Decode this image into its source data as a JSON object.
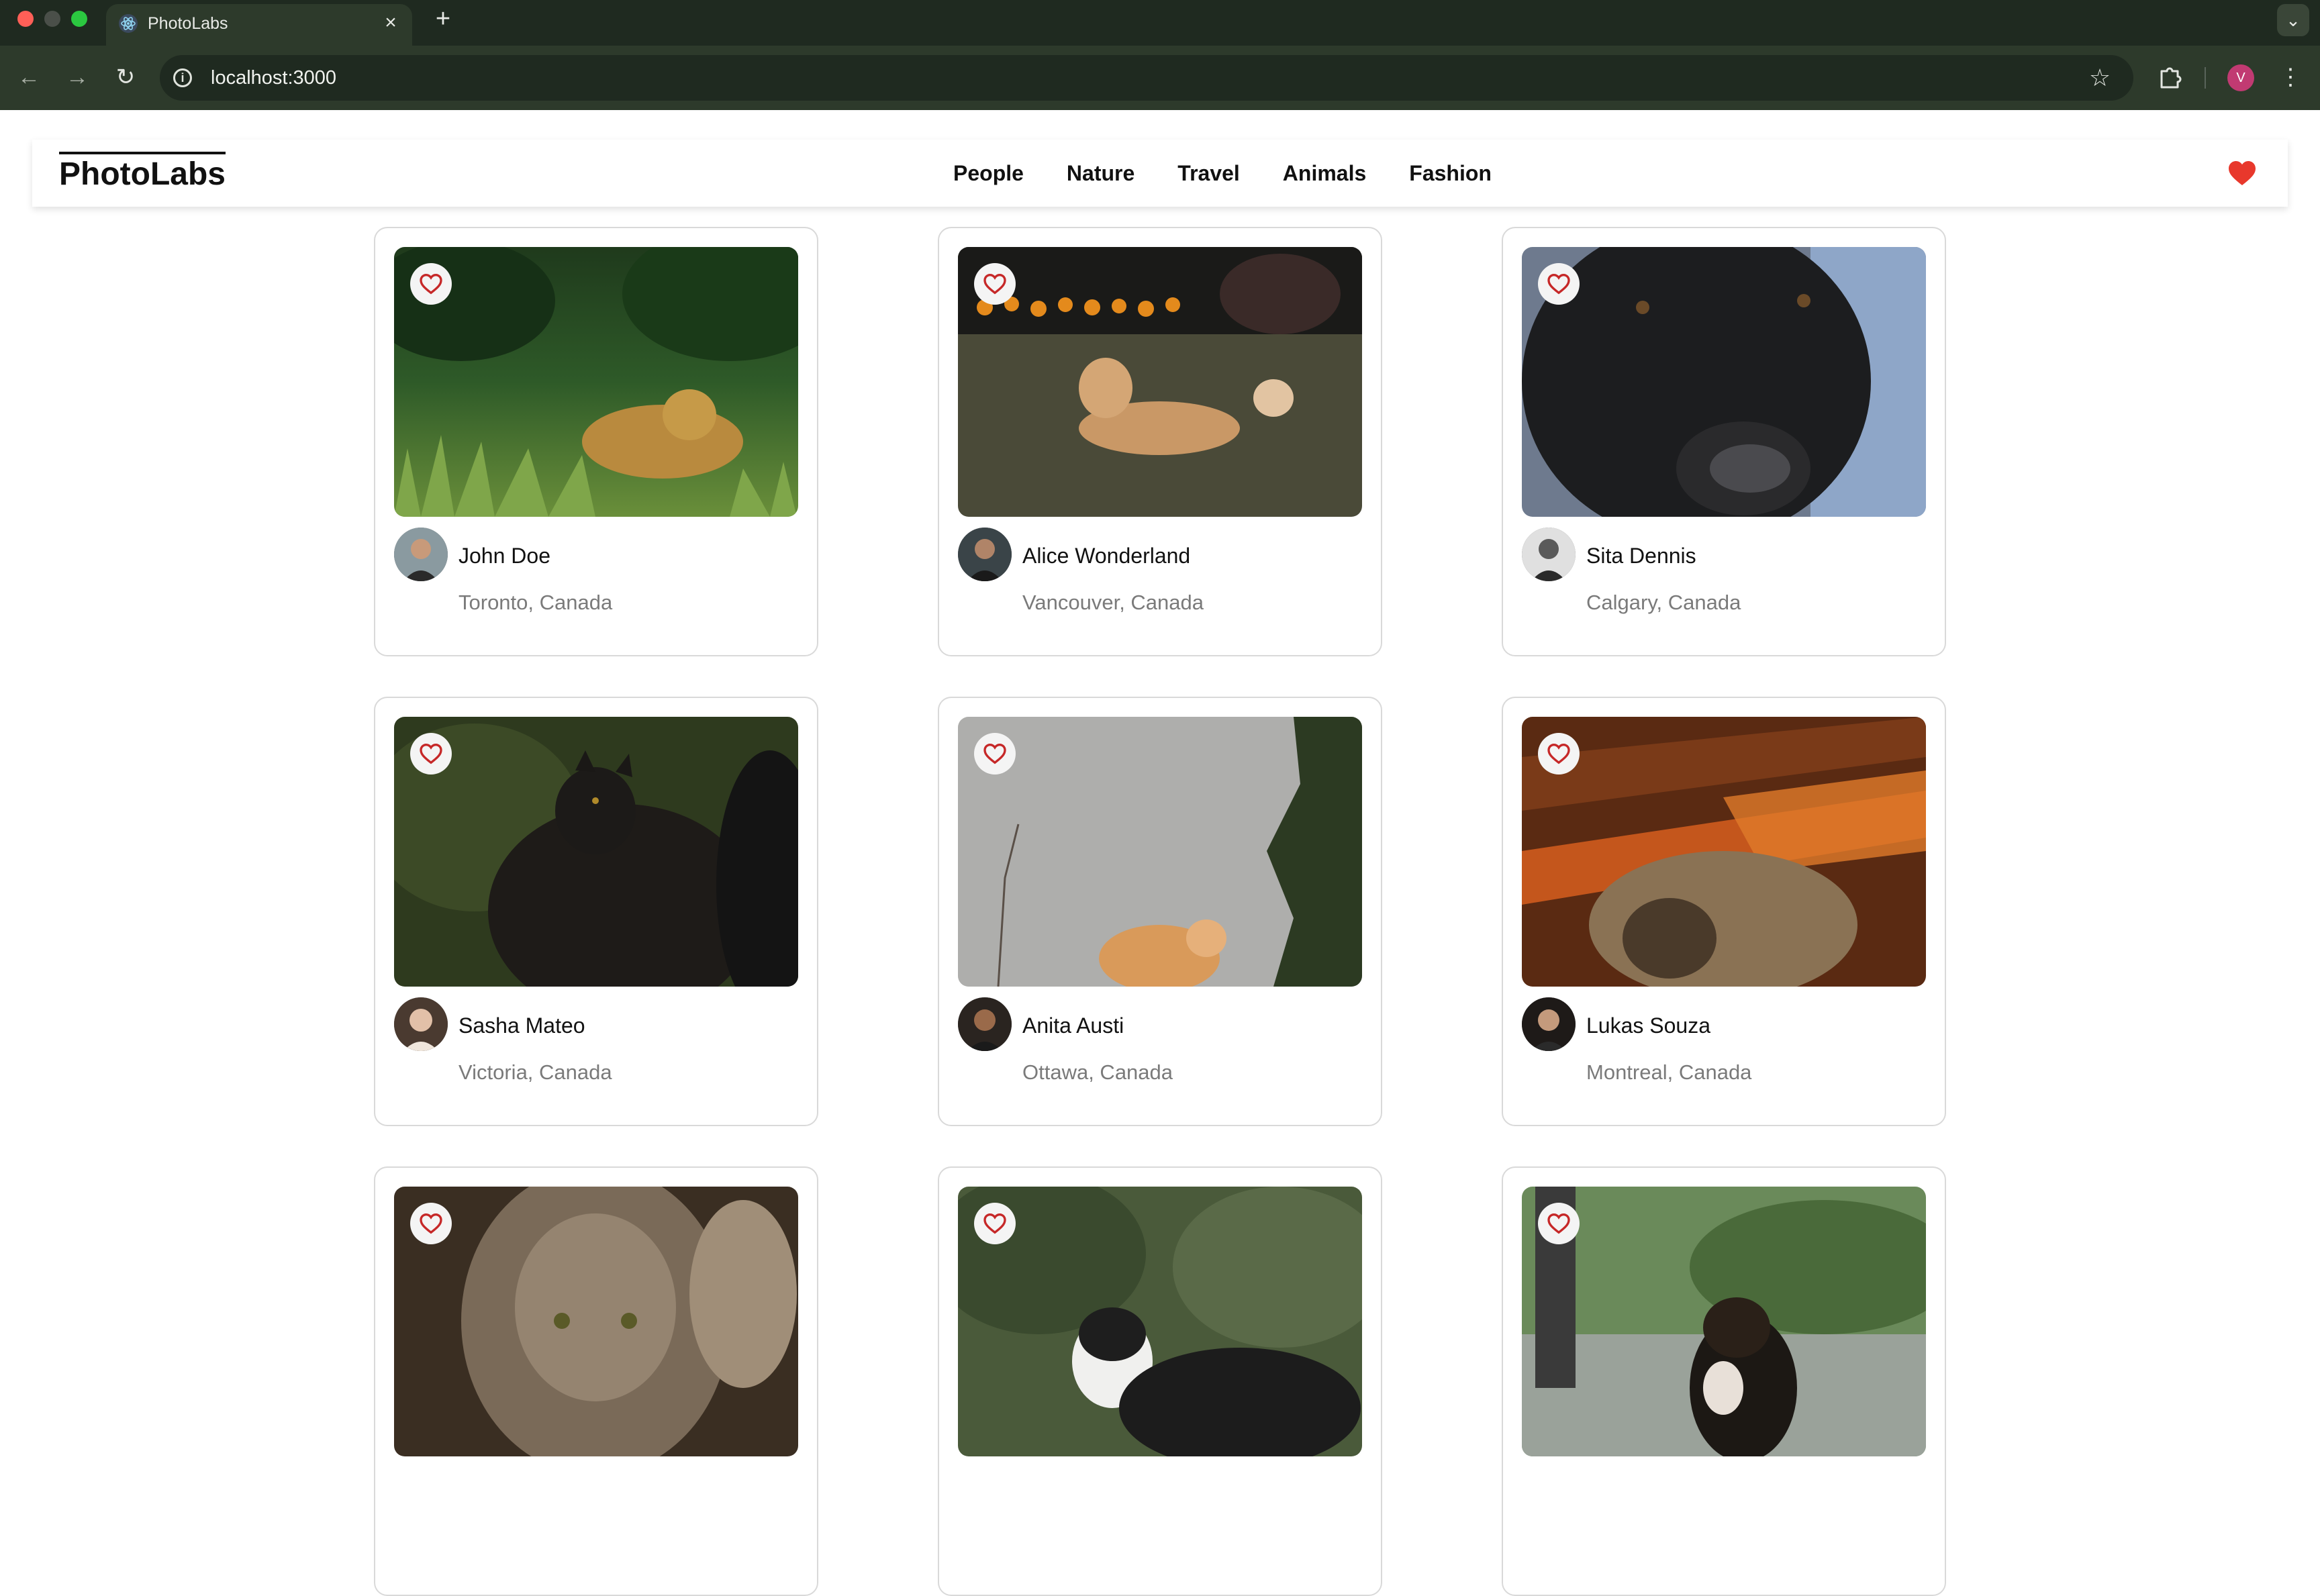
{
  "browser": {
    "tab_title": "PhotoLabs",
    "new_tab_glyph": "+",
    "url": "localhost:3000",
    "profile_initial": "V"
  },
  "app": {
    "logo": "PhotoLabs",
    "topics": [
      "People",
      "Nature",
      "Travel",
      "Animals",
      "Fashion"
    ],
    "fav_icon": "heart-filled-icon",
    "accent": "#e8382c"
  },
  "photos": [
    {
      "name": "John Doe",
      "location": "Toronto, Canada",
      "subject": "jaguar"
    },
    {
      "name": "Alice Wonderland",
      "location": "Vancouver, Canada",
      "subject": "dog-on-grass"
    },
    {
      "name": "Sita Dennis",
      "location": "Calgary, Canada",
      "subject": "black-dog-closeup"
    },
    {
      "name": "Sasha Mateo",
      "location": "Victoria, Canada",
      "subject": "black-cat"
    },
    {
      "name": "Anita Austi",
      "location": "Ottawa, Canada",
      "subject": "orange-cat-wall"
    },
    {
      "name": "Lukas Souza",
      "location": "Montreal, Canada",
      "subject": "tabby-on-rug"
    },
    {
      "name": "",
      "location": "",
      "subject": "tabby-drinking"
    },
    {
      "name": "",
      "location": "",
      "subject": "border-collie"
    },
    {
      "name": "",
      "location": "",
      "subject": "dog-paw-shake"
    }
  ]
}
